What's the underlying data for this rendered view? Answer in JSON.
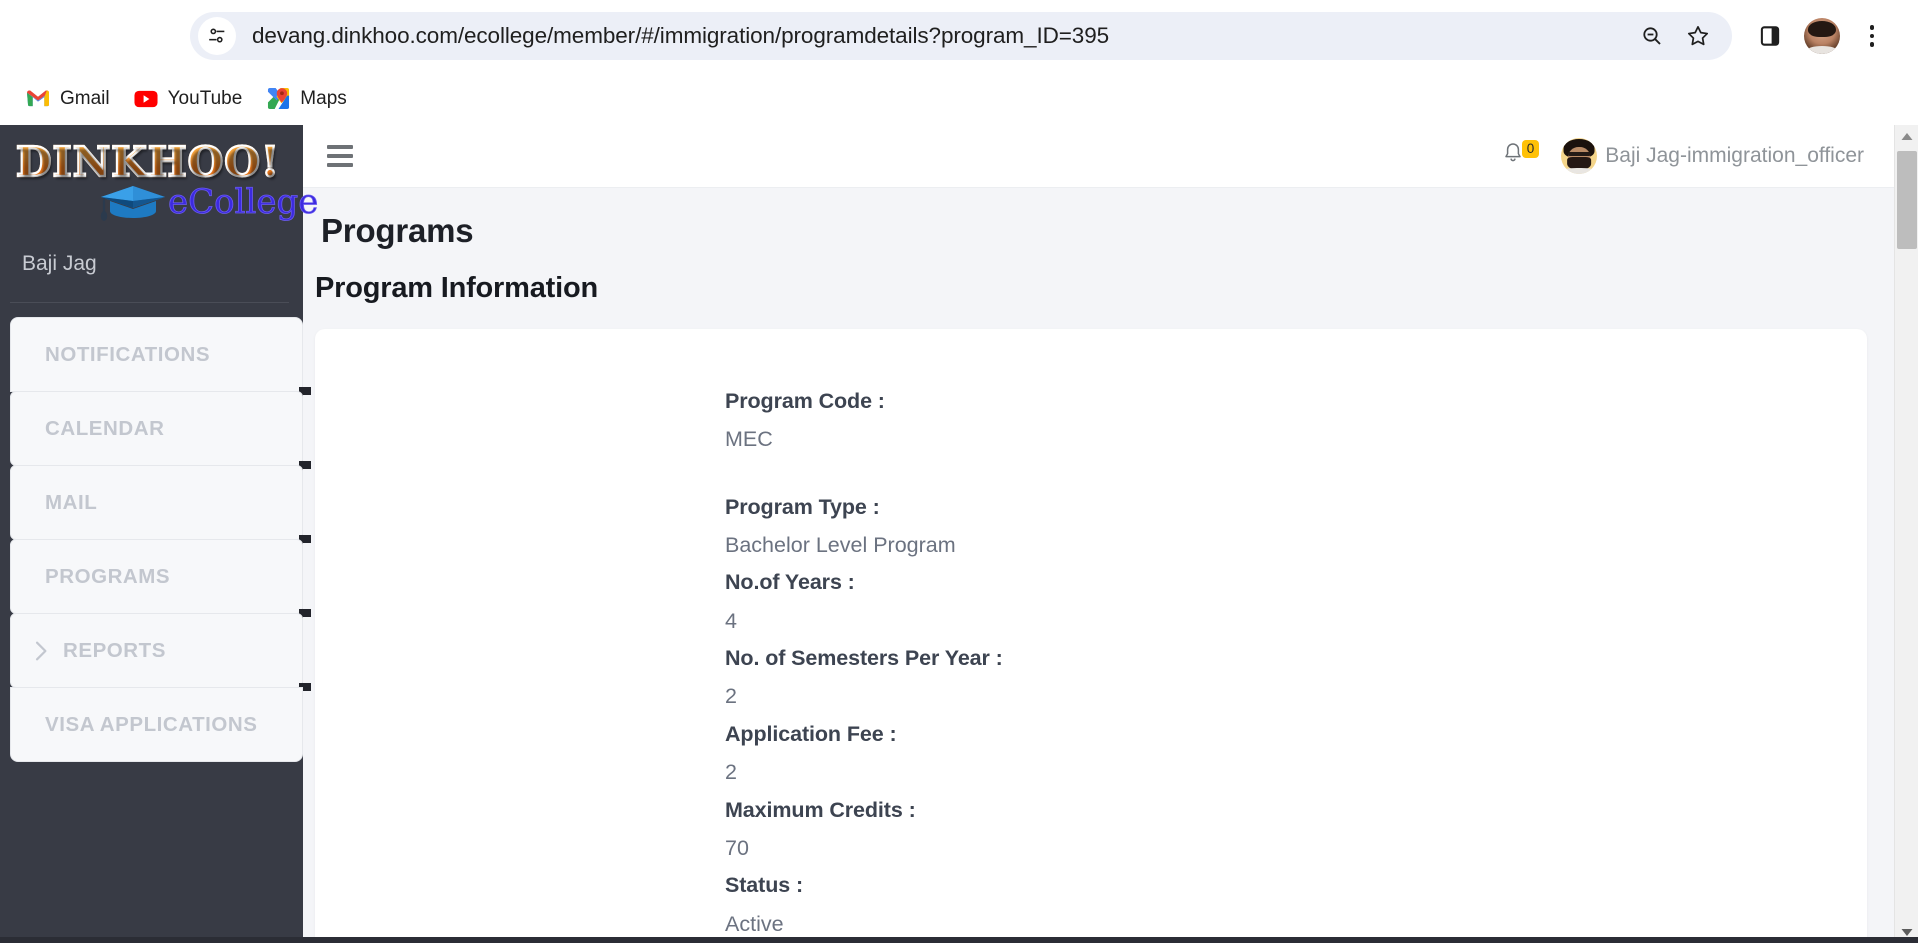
{
  "browser": {
    "url": "devang.dinkhoo.com/ecollege/member/#/immigration/programdetails?program_ID=395",
    "back_icon": "back-arrow-icon",
    "forward_icon": "forward-arrow-icon",
    "reload_icon": "reload-icon",
    "site_info_icon": "site-settings-icon",
    "zoom_icon": "zoom-out-icon",
    "bookmark_icon": "star-icon",
    "side_panel_icon": "side-panel-icon",
    "profile_icon": "profile-avatar-icon",
    "menu_icon": "three-dot-menu-icon",
    "bookmarks": [
      {
        "label": "Gmail",
        "icon": "gmail-icon"
      },
      {
        "label": "YouTube",
        "icon": "youtube-icon"
      },
      {
        "label": "Maps",
        "icon": "google-maps-icon"
      }
    ]
  },
  "sidebar": {
    "logo_primary": "DINKHOO!",
    "logo_secondary": "eCollege",
    "logo_cap_icon": "graduation-cap-icon",
    "user": "Baji Jag",
    "items": [
      {
        "label": "NOTIFICATIONS",
        "has_chevron": false
      },
      {
        "label": "CALENDAR",
        "has_chevron": false
      },
      {
        "label": "MAIL",
        "has_chevron": false
      },
      {
        "label": "PROGRAMS",
        "has_chevron": false
      },
      {
        "label": "REPORTS",
        "has_chevron": true
      },
      {
        "label": "VISA APPLICATIONS",
        "has_chevron": false
      }
    ]
  },
  "topbar": {
    "hamburger_icon": "hamburger-menu-icon",
    "bell_icon": "notification-bell-icon",
    "bell_count": "0",
    "user_name": "Baji Jag-immigration_officer",
    "avatar_icon": "user-avatar-icon"
  },
  "main": {
    "page_title": "Programs",
    "section_title": "Program Information",
    "fields": [
      {
        "label": "Program Code :",
        "value": "MEC"
      },
      {
        "label": "Program Type :",
        "value": "Bachelor Level Program"
      },
      {
        "label": "No.of Years :",
        "value": "4"
      },
      {
        "label": "No. of Semesters Per Year :",
        "value": "2"
      },
      {
        "label": "Application Fee :",
        "value": "2"
      },
      {
        "label": "Maximum Credits :",
        "value": "70"
      },
      {
        "label": "Status :",
        "value": "Active"
      }
    ]
  },
  "scrollbar": {
    "up_icon": "scroll-up-arrow-icon",
    "down_icon": "scroll-down-arrow-icon"
  },
  "colors": {
    "sidebar_bg": "#383b45",
    "page_bg": "#f4f5f8",
    "accent_badge": "#ffc107",
    "logo_orange": "#f59120",
    "logo_blue": "#3c2ae0"
  }
}
